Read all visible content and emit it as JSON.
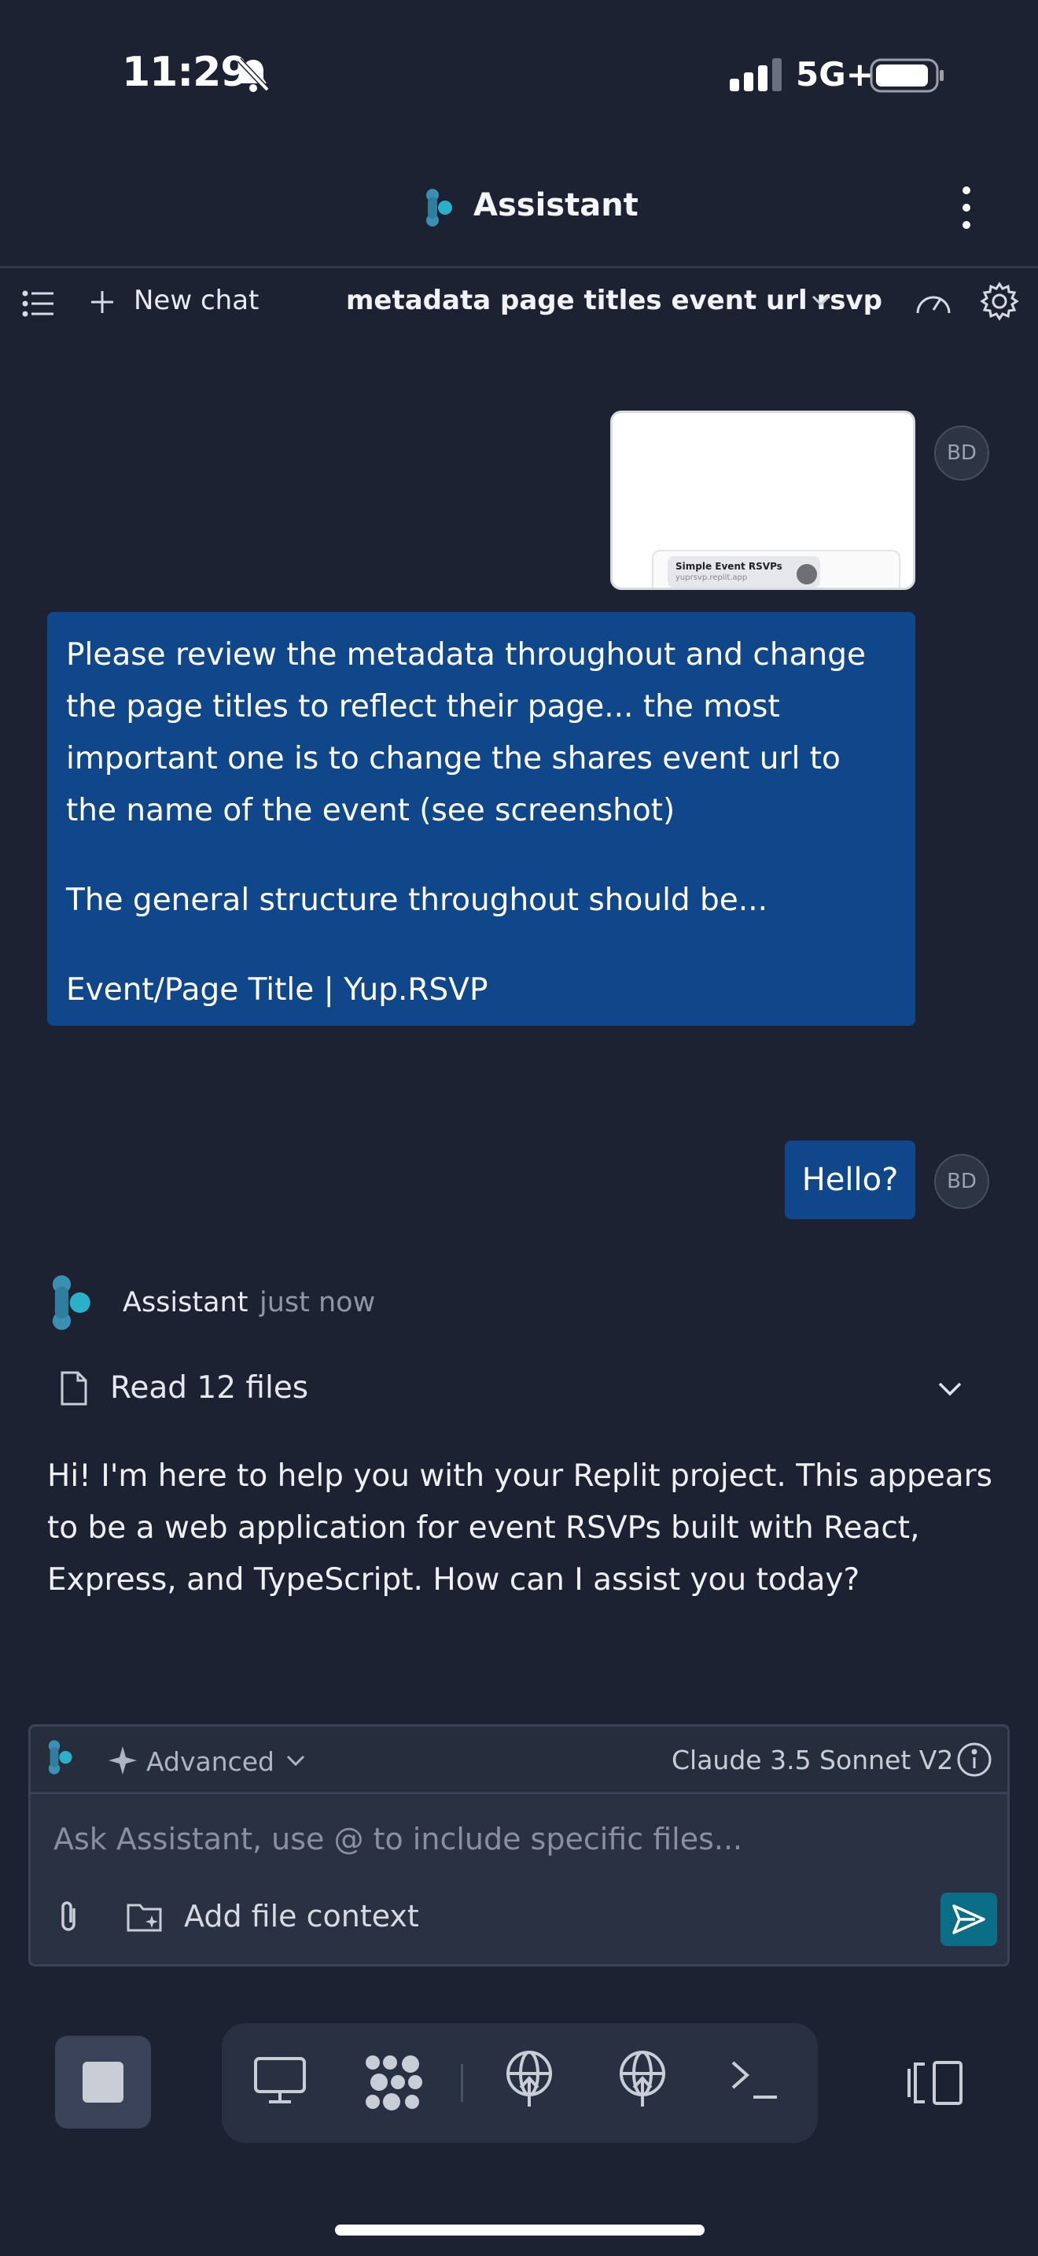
{
  "status_bar": {
    "time": "11:29",
    "network": "5G+"
  },
  "header": {
    "title": "Assistant"
  },
  "toolbar": {
    "new_chat_label": "New chat",
    "chat_title": "metadata page titles event url rsvp"
  },
  "user_initials": "BD",
  "attachment": {
    "card_title": "Simple Event RSVPs",
    "card_url": "yuprsvp.replit.app"
  },
  "messages": {
    "user_1_paragraphs": [
      "Please review the metadata throughout and change the page titles to reflect their page... the most important one is to change the shares event url to the name of the event (see screenshot)",
      "The general structure throughout should be...",
      "Event/Page Title | Yup.RSVP"
    ],
    "user_2": "Hello?",
    "assistant": {
      "name": "Assistant",
      "timestamp": "just now",
      "files_label": "Read 12 files",
      "text": "Hi! I'm here to help you with your Replit project. This appears to be a web application for event RSVPs built with React, Express, and TypeScript. How can I assist you today?"
    }
  },
  "composer": {
    "mode_label": "Advanced",
    "model_label": "Claude 3.5 Sonnet V2",
    "placeholder": "Ask Assistant, use @ to include specific files...",
    "add_context_label": "Add file context"
  },
  "icons": {
    "status": [
      "silent-bell-icon",
      "signal-icon",
      "battery-icon"
    ],
    "toolbar": [
      "list-icon",
      "plus-icon",
      "chevron-down-icon",
      "gauge-icon",
      "gear-icon"
    ],
    "bottom": [
      "stop-icon",
      "monitor-icon",
      "dots-icon",
      "deploy-icon",
      "deploy-icon",
      "shell-icon",
      "panes-icon"
    ]
  },
  "colors": {
    "background": "#1c2232",
    "user_bubble": "#10478a",
    "accent": "#0b6d86"
  }
}
